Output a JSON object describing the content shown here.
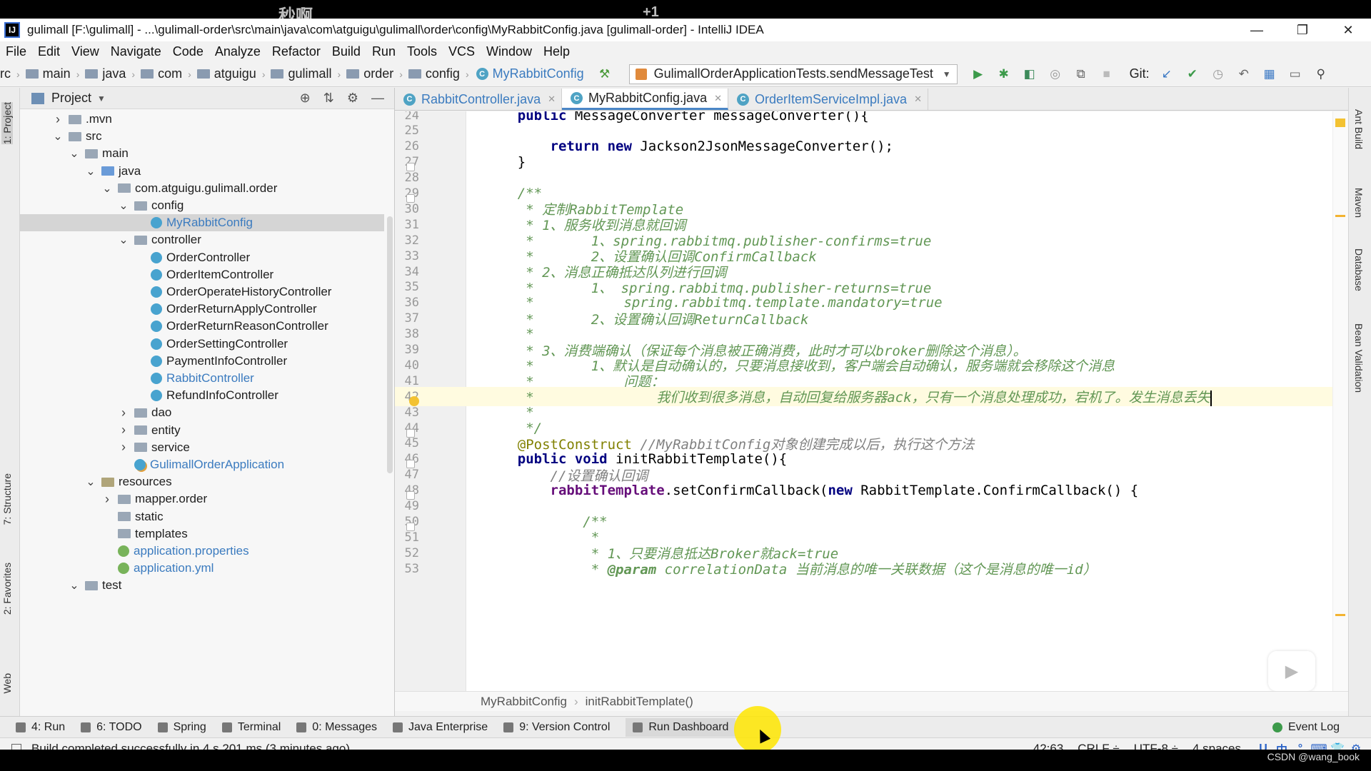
{
  "window": {
    "title": "gulimall [F:\\gulimall] - ...\\gulimall-order\\src\\main\\java\\com\\atguigu\\gulimall\\order\\config\\MyRabbitConfig.java [gulimall-order] - IntelliJ IDEA",
    "minimize": "—",
    "restore": "❐",
    "close": "✕",
    "watermark_a": "秒啊",
    "watermark_b": "+1"
  },
  "menu": [
    "File",
    "Edit",
    "View",
    "Navigate",
    "Code",
    "Analyze",
    "Refactor",
    "Build",
    "Run",
    "Tools",
    "VCS",
    "Window",
    "Help"
  ],
  "nav": {
    "crumbs": [
      "rc",
      "main",
      "java",
      "com",
      "atguigu",
      "gulimall",
      "order",
      "config",
      "MyRabbitConfig"
    ],
    "run_config": "GulimallOrderApplicationTests.sendMessageTest",
    "git_label": "Git:"
  },
  "left_strip": {
    "project": "1: Project",
    "structure": "7: Structure",
    "favorites": "2: Favorites",
    "web": "Web"
  },
  "right_strip": {
    "ant": "Ant Build",
    "maven": "Maven",
    "database": "Database",
    "bean": "Bean Validation"
  },
  "project": {
    "title": "Project",
    "tree": [
      {
        "label": ".mvn",
        "depth": 0,
        "tw": "right",
        "icon": "folder"
      },
      {
        "label": "src",
        "depth": 0,
        "tw": "down",
        "icon": "folder"
      },
      {
        "label": "main",
        "depth": 1,
        "tw": "down",
        "icon": "folder"
      },
      {
        "label": "java",
        "depth": 2,
        "tw": "down",
        "icon": "src"
      },
      {
        "label": "com.atguigu.gulimall.order",
        "depth": 3,
        "tw": "down",
        "icon": "folder"
      },
      {
        "label": "config",
        "depth": 4,
        "tw": "down",
        "icon": "folder"
      },
      {
        "label": "MyRabbitConfig",
        "depth": 5,
        "tw": "",
        "icon": "class",
        "selected": true,
        "highlight": true
      },
      {
        "label": "controller",
        "depth": 4,
        "tw": "down",
        "icon": "folder"
      },
      {
        "label": "OrderController",
        "depth": 5,
        "tw": "",
        "icon": "class"
      },
      {
        "label": "OrderItemController",
        "depth": 5,
        "tw": "",
        "icon": "class"
      },
      {
        "label": "OrderOperateHistoryController",
        "depth": 5,
        "tw": "",
        "icon": "class"
      },
      {
        "label": "OrderReturnApplyController",
        "depth": 5,
        "tw": "",
        "icon": "class"
      },
      {
        "label": "OrderReturnReasonController",
        "depth": 5,
        "tw": "",
        "icon": "class"
      },
      {
        "label": "OrderSettingController",
        "depth": 5,
        "tw": "",
        "icon": "class"
      },
      {
        "label": "PaymentInfoController",
        "depth": 5,
        "tw": "",
        "icon": "class"
      },
      {
        "label": "RabbitController",
        "depth": 5,
        "tw": "",
        "icon": "class",
        "highlight": true
      },
      {
        "label": "RefundInfoController",
        "depth": 5,
        "tw": "",
        "icon": "class"
      },
      {
        "label": "dao",
        "depth": 4,
        "tw": "right",
        "icon": "folder"
      },
      {
        "label": "entity",
        "depth": 4,
        "tw": "right",
        "icon": "folder"
      },
      {
        "label": "service",
        "depth": 4,
        "tw": "right",
        "icon": "folder"
      },
      {
        "label": "GulimallOrderApplication",
        "depth": 4,
        "tw": "",
        "icon": "app",
        "highlight": true
      },
      {
        "label": "resources",
        "depth": 2,
        "tw": "down",
        "icon": "res"
      },
      {
        "label": "mapper.order",
        "depth": 3,
        "tw": "right",
        "icon": "folder"
      },
      {
        "label": "static",
        "depth": 3,
        "tw": "",
        "icon": "folder"
      },
      {
        "label": "templates",
        "depth": 3,
        "tw": "",
        "icon": "folder"
      },
      {
        "label": "application.properties",
        "depth": 3,
        "tw": "",
        "icon": "leaf",
        "highlight": true
      },
      {
        "label": "application.yml",
        "depth": 3,
        "tw": "",
        "icon": "leaf",
        "highlight": true
      },
      {
        "label": "test",
        "depth": 1,
        "tw": "down",
        "icon": "folder"
      }
    ]
  },
  "tabs": [
    {
      "label": "RabbitController.java",
      "active": false
    },
    {
      "label": "MyRabbitConfig.java",
      "active": true
    },
    {
      "label": "OrderItemServiceImpl.java",
      "active": false
    }
  ],
  "editor": {
    "lines": [
      {
        "n": "24",
        "segs": [
          [
            "kw",
            "    public "
          ],
          [
            "",
            "MessageConverter messageConverter(){"
          ]
        ]
      },
      {
        "n": "25",
        "segs": []
      },
      {
        "n": "26",
        "segs": [
          [
            "",
            "        "
          ],
          [
            "kw",
            "return new "
          ],
          [
            "",
            "Jackson2JsonMessageConverter();"
          ]
        ]
      },
      {
        "n": "27",
        "segs": [
          [
            "",
            "    }"
          ]
        ],
        "fold": true
      },
      {
        "n": "28",
        "segs": []
      },
      {
        "n": "29",
        "segs": [
          [
            "doc",
            "    /**"
          ]
        ],
        "fold": true
      },
      {
        "n": "30",
        "segs": [
          [
            "doc",
            "     * 定制RabbitTemplate"
          ]
        ]
      },
      {
        "n": "31",
        "segs": [
          [
            "doc",
            "     * 1、服务收到消息就回调"
          ]
        ]
      },
      {
        "n": "32",
        "segs": [
          [
            "doc",
            "     *       1、spring.rabbitmq.publisher-confirms=true"
          ]
        ]
      },
      {
        "n": "33",
        "segs": [
          [
            "doc",
            "     *       2、设置确认回调ConfirmCallback"
          ]
        ]
      },
      {
        "n": "34",
        "segs": [
          [
            "doc",
            "     * 2、消息正确抵达队列进行回调"
          ]
        ]
      },
      {
        "n": "35",
        "segs": [
          [
            "doc",
            "     *       1、 spring.rabbitmq.publisher-returns=true"
          ]
        ]
      },
      {
        "n": "36",
        "segs": [
          [
            "doc",
            "     *           spring.rabbitmq.template.mandatory=true"
          ]
        ]
      },
      {
        "n": "37",
        "segs": [
          [
            "doc",
            "     *       2、设置确认回调ReturnCallback"
          ]
        ]
      },
      {
        "n": "38",
        "segs": [
          [
            "doc",
            "     *"
          ]
        ]
      },
      {
        "n": "39",
        "segs": [
          [
            "doc",
            "     * 3、消费端确认（保证每个消息被正确消费，此时才可以broker删除这个消息）。"
          ]
        ]
      },
      {
        "n": "40",
        "segs": [
          [
            "doc",
            "     *       1、默认是自动确认的，只要消息接收到，客户端会自动确认，服务端就会移除这个消息"
          ]
        ]
      },
      {
        "n": "41",
        "segs": [
          [
            "doc",
            "     *           问题："
          ]
        ]
      },
      {
        "n": "42",
        "segs": [
          [
            "doc",
            "     *               我们收到很多消息，自动回复给服务器ack，只有一个消息处理成功，宕机了。发生消息丢失"
          ]
        ],
        "caret": true,
        "bulb": true
      },
      {
        "n": "43",
        "segs": [
          [
            "doc",
            "     *"
          ]
        ]
      },
      {
        "n": "44",
        "segs": [
          [
            "doc",
            "     */"
          ]
        ],
        "fold": true
      },
      {
        "n": "45",
        "segs": [
          [
            "ann",
            "    @PostConstruct "
          ],
          [
            "cmt",
            "//MyRabbitConfig对象创建完成以后，执行这个方法"
          ]
        ]
      },
      {
        "n": "46",
        "segs": [
          [
            "kw",
            "    public void "
          ],
          [
            "",
            "initRabbitTemplate(){"
          ]
        ],
        "fold": true
      },
      {
        "n": "47",
        "segs": [
          [
            "cmt",
            "        //设置确认回调"
          ]
        ]
      },
      {
        "n": "48",
        "segs": [
          [
            "fld",
            "        rabbitTemplate"
          ],
          [
            "",
            ".setConfirmCallback("
          ],
          [
            "kw",
            "new "
          ],
          [
            "",
            "RabbitTemplate.ConfirmCallback() {"
          ]
        ],
        "fold": true
      },
      {
        "n": "49",
        "segs": []
      },
      {
        "n": "50",
        "segs": [
          [
            "doc",
            "            /**"
          ]
        ],
        "fold": true
      },
      {
        "n": "51",
        "segs": [
          [
            "doc",
            "             *"
          ]
        ]
      },
      {
        "n": "52",
        "segs": [
          [
            "doc",
            "             * 1、只要消息抵达Broker就ack=true"
          ]
        ]
      },
      {
        "n": "53",
        "segs": [
          [
            "doc",
            "             * "
          ],
          [
            "doc-tag",
            "@param "
          ],
          [
            "doc",
            "correlationData 当前消息的唯一关联数据（这个是消息的唯一id）"
          ]
        ]
      }
    ],
    "breadcrumb": [
      "MyRabbitConfig",
      "initRabbitTemplate()"
    ]
  },
  "toolwindows": [
    {
      "label": "4: Run"
    },
    {
      "label": "6: TODO"
    },
    {
      "label": "Spring"
    },
    {
      "label": "Terminal"
    },
    {
      "label": "0: Messages"
    },
    {
      "label": "Java Enterprise"
    },
    {
      "label": "9: Version Control"
    },
    {
      "label": "Run Dashboard",
      "active": true
    }
  ],
  "event_log": "Event Log",
  "status": {
    "message": "Build completed successfully in 4 s 201 ms (3 minutes ago)",
    "position": "42:63",
    "line_sep": "CRLF ÷",
    "encoding": "UTF-8 ÷",
    "indent": "4 spaces",
    "ime": [
      "U",
      "中",
      "°",
      "⌨",
      "👕",
      "⚙"
    ]
  },
  "csdn": "CSDN @wang_book",
  "colors": {
    "accent": "#4a86c7",
    "doc": "#629755",
    "keyword": "#000080"
  }
}
